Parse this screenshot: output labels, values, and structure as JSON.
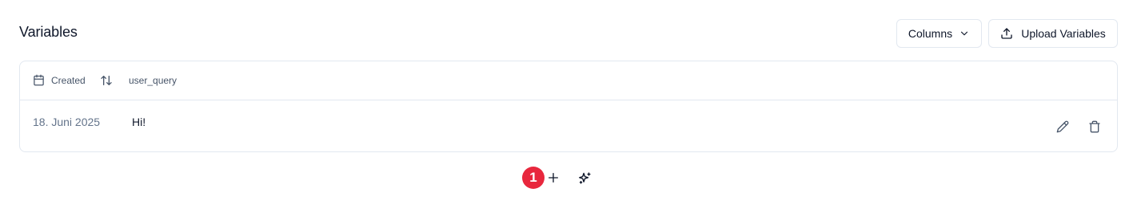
{
  "header": {
    "title": "Variables",
    "columns_label": "Columns",
    "upload_label": "Upload Variables"
  },
  "table": {
    "columns": [
      "Created",
      "user_query"
    ],
    "rows": [
      {
        "created": "18. Juni 2025",
        "user_query": "Hi!"
      }
    ]
  },
  "footer": {
    "badge": "1"
  },
  "icons": {
    "columns": "chevron-down-icon",
    "upload": "upload-icon",
    "created": "calendar-icon",
    "sort": "sort-arrows-icon",
    "edit": "pencil-icon",
    "delete": "trash-icon",
    "add": "plus-icon",
    "generate": "sparkles-icon"
  },
  "colors": {
    "badge": "#e8273d",
    "border": "#e2e8f0",
    "muted_text": "#64748b"
  }
}
